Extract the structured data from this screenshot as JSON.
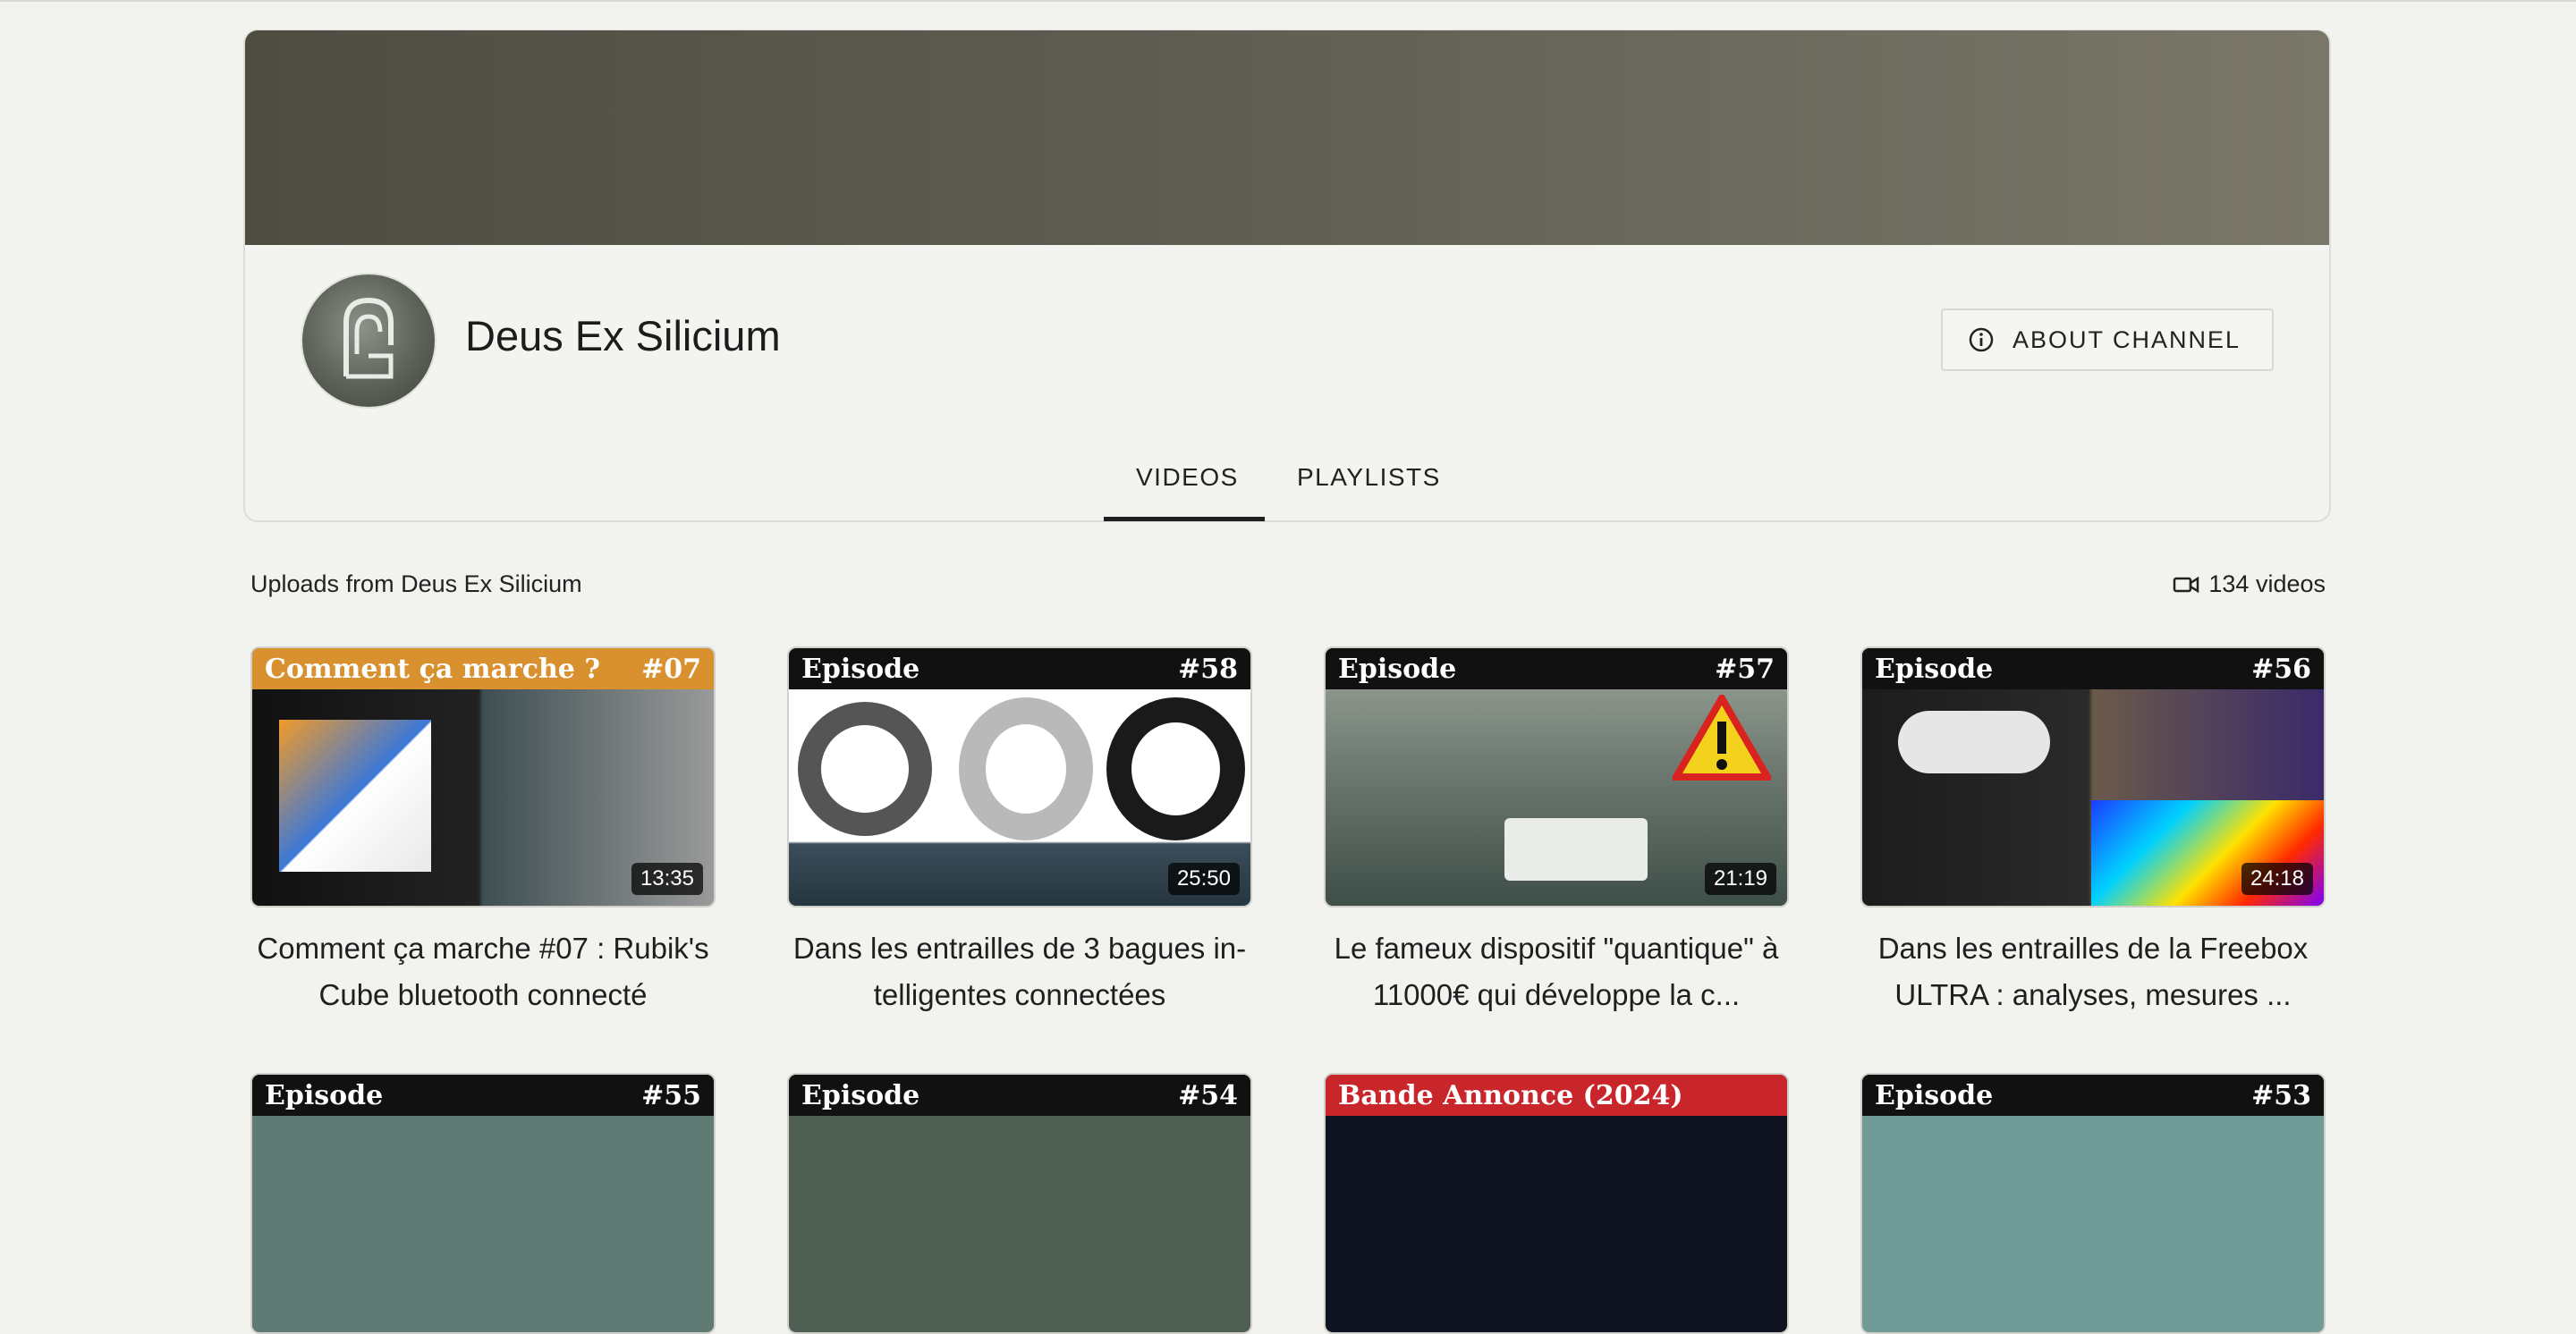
{
  "channel": {
    "name": "Deus Ex Silicium",
    "about_label": "ABOUT CHANNEL"
  },
  "tabs": [
    {
      "label": "VIDEOS",
      "active": true
    },
    {
      "label": "PLAYLISTS",
      "active": false
    }
  ],
  "uploads": {
    "label": "Uploads from Deus Ex Silicium",
    "count_label": "134 videos"
  },
  "videos": [
    {
      "header_left": "Comment ça marche ?",
      "header_right": "#07",
      "header_color": "#d9902f",
      "duration": "13:35",
      "title_line1": "Comment ça marche #07 : Rubik's",
      "title_line2": "Cube bluetooth connecté"
    },
    {
      "header_left": "Episode",
      "header_right": "#58",
      "header_color": "#111111",
      "duration": "25:50",
      "title_line1": "Dans les entrailles de 3 bagues in-",
      "title_line2": "telligentes connectées"
    },
    {
      "header_left": "Episode",
      "header_right": "#57",
      "header_color": "#111111",
      "duration": "21:19",
      "title_line1": "Le fameux dispositif \"quantique\" à",
      "title_line2": "11000€ qui développe la c..."
    },
    {
      "header_left": "Episode",
      "header_right": "#56",
      "header_color": "#111111",
      "duration": "24:18",
      "title_line1": "Dans les entrailles de la Freebox",
      "title_line2": "ULTRA : analyses, mesures ..."
    },
    {
      "header_left": "Episode",
      "header_right": "#55",
      "header_color": "#111111"
    },
    {
      "header_left": "Episode",
      "header_right": "#54",
      "header_color": "#111111"
    },
    {
      "header_left": "Bande Annonce  (2024)",
      "header_right": "",
      "header_color": "#c8262a"
    },
    {
      "header_left": "Episode",
      "header_right": "#53",
      "header_color": "#111111"
    }
  ]
}
